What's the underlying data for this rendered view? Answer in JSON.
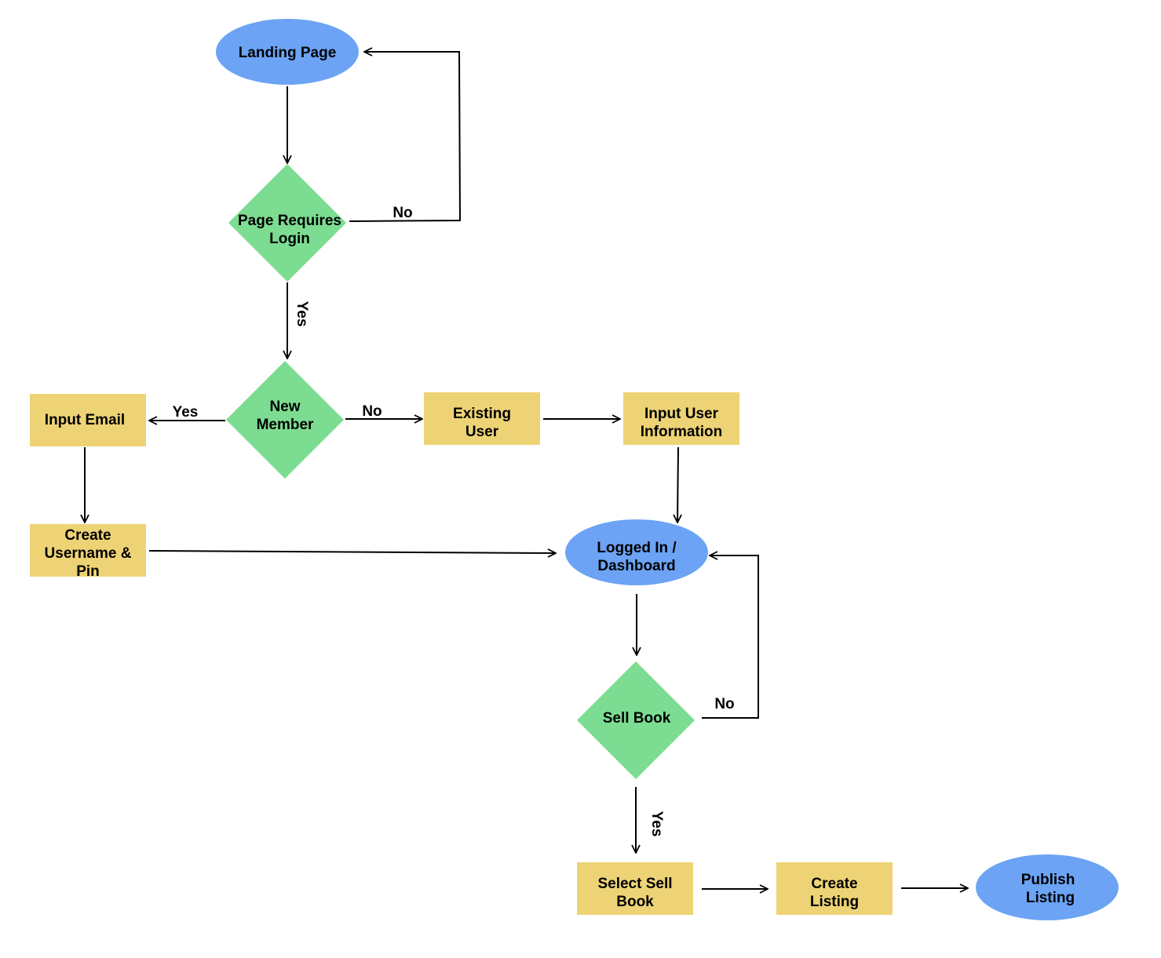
{
  "colors": {
    "terminal": "#6ca3f4",
    "decision": "#7cdc91",
    "process": "#edd375",
    "line": "#000000"
  },
  "nodes": {
    "landing": {
      "label": [
        "Landing Page"
      ],
      "shape": "ellipse"
    },
    "requires_login": {
      "label": [
        "Page Requires",
        "Login"
      ],
      "shape": "diamond"
    },
    "new_member": {
      "label": [
        "New",
        "Member"
      ],
      "shape": "diamond"
    },
    "input_email": {
      "label": [
        "Input Email"
      ],
      "shape": "rectangle"
    },
    "create_username": {
      "label": [
        "Create",
        "Username &",
        "Pin"
      ],
      "shape": "rectangle"
    },
    "existing_user": {
      "label": [
        "Existing",
        "User"
      ],
      "shape": "rectangle"
    },
    "input_user_info": {
      "label": [
        "Input User",
        "Information"
      ],
      "shape": "rectangle"
    },
    "dashboard": {
      "label": [
        "Logged In /",
        "Dashboard"
      ],
      "shape": "ellipse"
    },
    "sell_book": {
      "label": [
        "Sell Book"
      ],
      "shape": "diamond"
    },
    "select_sell_book": {
      "label": [
        "Select Sell",
        "Book"
      ],
      "shape": "rectangle"
    },
    "create_listing": {
      "label": [
        "Create",
        "Listing"
      ],
      "shape": "rectangle"
    },
    "publish_listing": {
      "label": [
        "Publish",
        "Listing"
      ],
      "shape": "ellipse"
    }
  },
  "edges": {
    "login_no": "No",
    "login_yes": "Yes",
    "member_yes": "Yes",
    "member_no": "No",
    "sell_no": "No",
    "sell_yes": "Yes"
  }
}
